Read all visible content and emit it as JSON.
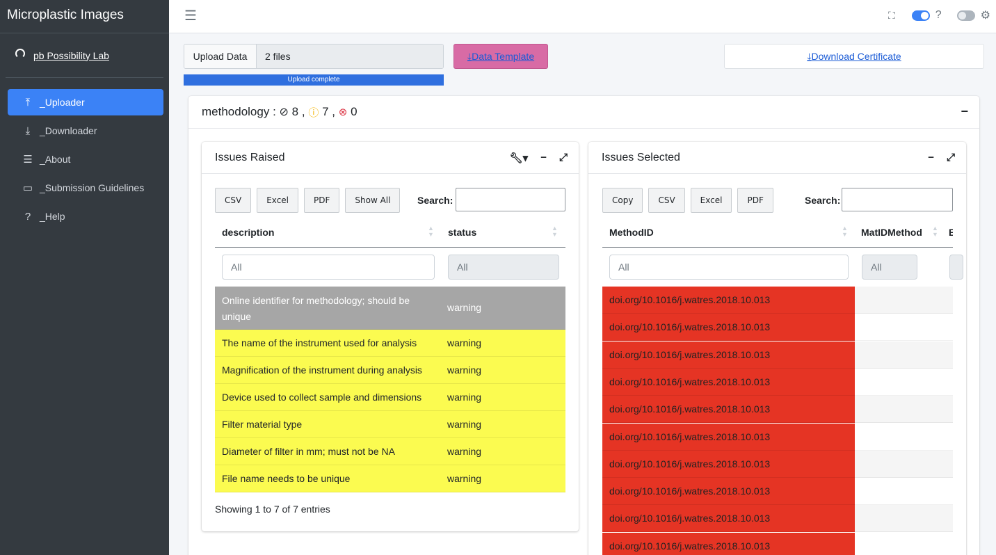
{
  "app": {
    "title": "Microplastic Images"
  },
  "user": {
    "name": "pb Possibility Lab"
  },
  "sidebar": {
    "items": [
      {
        "label": "_Uploader",
        "icon": "upload-icon",
        "active": true
      },
      {
        "label": "_Downloader",
        "icon": "download-icon",
        "active": false
      },
      {
        "label": "_About",
        "icon": "sliders-icon",
        "active": false
      },
      {
        "label": "_Submission Guidelines",
        "icon": "laptop-icon",
        "active": false
      },
      {
        "label": "_Help",
        "icon": "question-icon",
        "active": false
      }
    ]
  },
  "header": {
    "help_mark": "?"
  },
  "upload": {
    "button_label": "Upload Data",
    "files_value": "2 files",
    "progress_text": "Upload complete",
    "template_label": "Data Template",
    "certificate_label": "Download Certificate"
  },
  "methodology": {
    "label": "methodology",
    "ok_count": "8",
    "warn_count": "7",
    "err_count": "0",
    "separator_colon": " : ",
    "comma": ","
  },
  "issues_raised": {
    "title": "Issues Raised",
    "buttons": [
      "CSV",
      "Excel",
      "PDF",
      "Show All"
    ],
    "search_label": "Search:",
    "columns": [
      "description",
      "status"
    ],
    "filters": [
      "All",
      "All"
    ],
    "rows": [
      {
        "description": "Online identifier for methodology; should be unique",
        "status": "warning",
        "highlight": "#a6a6a6"
      },
      {
        "description": "The name of the instrument used for analysis",
        "status": "warning",
        "highlight": "#fbfb50"
      },
      {
        "description": "Magnification of the instrument during analysis",
        "status": "warning",
        "highlight": "#fbfb50"
      },
      {
        "description": "Device used to collect sample and dimensions",
        "status": "warning",
        "highlight": "#fbfb50"
      },
      {
        "description": "Filter material type",
        "status": "warning",
        "highlight": "#fbfb50"
      },
      {
        "description": "Diameter of filter in mm; must not be NA",
        "status": "warning",
        "highlight": "#fbfb50"
      },
      {
        "description": "File name needs to be unique",
        "status": "warning",
        "highlight": "#fbfb50"
      }
    ],
    "info": "Showing 1 to 7 of 7 entries"
  },
  "issues_selected": {
    "title": "Issues Selected",
    "buttons": [
      "Copy",
      "CSV",
      "Excel",
      "PDF"
    ],
    "search_label": "Search:",
    "columns": [
      "MethodID",
      "MatIDMethod",
      "E"
    ],
    "filters": [
      "All",
      "All"
    ],
    "rows": [
      "doi.org/10.1016/j.watres.2018.10.013",
      "doi.org/10.1016/j.watres.2018.10.013",
      "doi.org/10.1016/j.watres.2018.10.013",
      "doi.org/10.1016/j.watres.2018.10.013",
      "doi.org/10.1016/j.watres.2018.10.013",
      "doi.org/10.1016/j.watres.2018.10.013",
      "doi.org/10.1016/j.watres.2018.10.013",
      "doi.org/10.1016/j.watres.2018.10.013",
      "doi.org/10.1016/j.watres.2018.10.013",
      "doi.org/10.1016/j.watres.2018.10.013"
    ]
  },
  "colors": {
    "accent": "#3b82f6",
    "template_btn": "#d86ba5",
    "error_cell": "#e53424",
    "warning_row": "#fbfb50",
    "sidebar_bg": "#343a40"
  }
}
